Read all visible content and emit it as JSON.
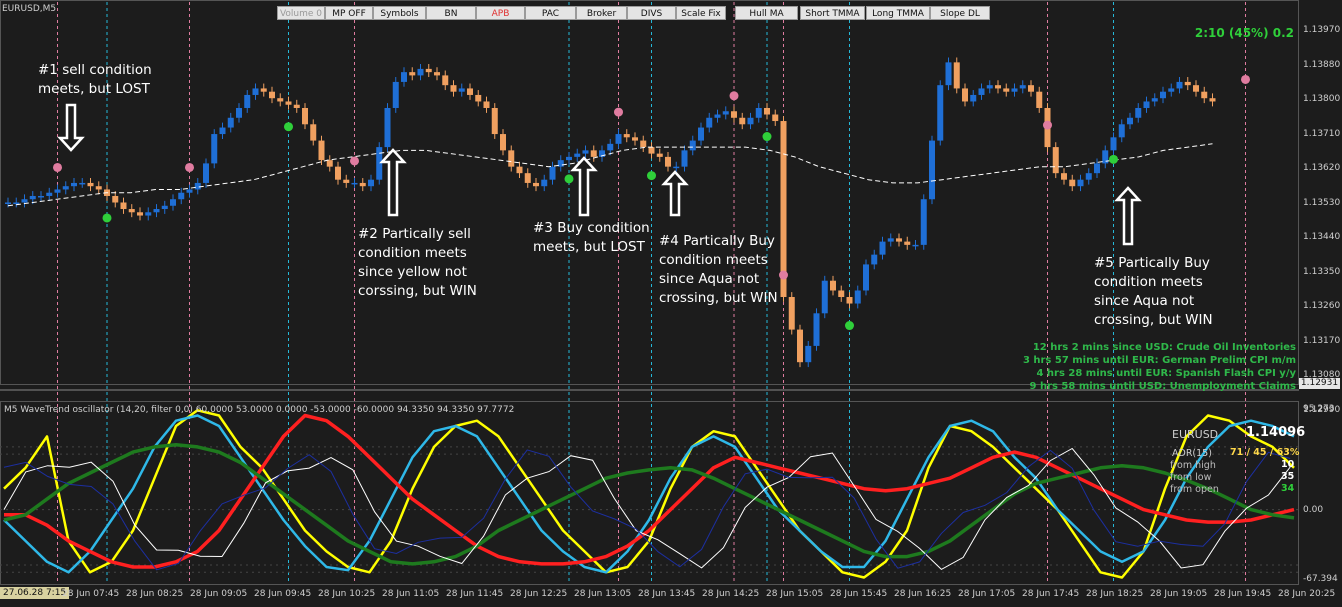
{
  "symbol": "EURUSD,M5",
  "toolbar": [
    {
      "label": "Volume 0",
      "style": "dim"
    },
    {
      "label": "MP OFF",
      "style": ""
    },
    {
      "label": "Symbols",
      "style": ""
    },
    {
      "label": "BN",
      "style": ""
    },
    {
      "label": "APB",
      "style": "red"
    },
    {
      "label": "PAC",
      "style": ""
    },
    {
      "label": "Broker",
      "style": ""
    },
    {
      "label": "DIVS",
      "style": ""
    },
    {
      "label": "Scale Fix",
      "style": ""
    },
    {
      "label": "Hull MA",
      "style": ""
    },
    {
      "label": "Short TMMA",
      "style": ""
    },
    {
      "label": "Long TMMA",
      "style": ""
    },
    {
      "label": "Slope DL",
      "style": ""
    }
  ],
  "stat": "2:10 (45%) 0.2",
  "annotations": [
    {
      "text": "#1 sell condition\nmeets, but LOST"
    },
    {
      "text": "#2 Partically sell\ncondition meets\nsince yellow not\ncorssing, but WIN"
    },
    {
      "text": "#3 Buy condition\nmeets, but LOST"
    },
    {
      "text": "#4 Partically Buy\ncondition meets\nsince Aqua not\ncrossing, but WIN"
    },
    {
      "text": "#5 Partically Buy\ncondition meets\nsince Aqua not\ncrossing, but WIN"
    }
  ],
  "news": [
    "12 hrs 2 mins since USD: Crude Oil Inventories",
    "3 hrs 57 mins until EUR: German Prelim CPI m/m",
    "4 hrs 28 mins until EUR: Spanish Flash CPI y/y",
    "9 hrs 58 mins until USD: Unemployment Claims"
  ],
  "price_axis": [
    "1.13970",
    "1.13880",
    "1.13800",
    "1.13710",
    "1.13620",
    "1.13530",
    "1.13440",
    "1.13350",
    "1.13260",
    "1.13170",
    "1.13080",
    "1.12990"
  ],
  "current_price": "1.12931",
  "osc_title": "M5 WaveTrend oscillator (14,20, filter 0,0) 60.0000 53.0000 0.0000 -53.0000 -60.0000 94.3350 94.3350 97.7772",
  "osc_axis": {
    "top": "95.273",
    "mid": "0.00",
    "bottom": "-67.394"
  },
  "time_first": "27.06.28 7:15",
  "time_axis": [
    "28 Jun 07:45",
    "28 Jun 08:25",
    "28 Jun 09:05",
    "28 Jun 09:45",
    "28 Jun 10:25",
    "28 Jun 11:05",
    "28 Jun 11:45",
    "28 Jun 12:25",
    "28 Jun 13:05",
    "28 Jun 13:45",
    "28 Jun 14:25",
    "28 Jun 15:05",
    "28 Jun 15:45",
    "28 Jun 16:25",
    "28 Jun 17:05",
    "28 Jun 17:45",
    "28 Jun 18:25",
    "28 Jun 19:05",
    "28 Jun 19:45",
    "28 Jun 20:25"
  ],
  "info_panel": {
    "symbol": "EURUSD",
    "price": "1.14096",
    "adr_label": "ADR(15)",
    "adr_value": "71 / 45 / 63%",
    "rows": [
      {
        "label": "from high",
        "value": "10",
        "color": "#ffffff"
      },
      {
        "label": "from low",
        "value": "35",
        "color": "#ffffff"
      },
      {
        "label": "from open",
        "value": "34",
        "color": "#2fcf3a"
      }
    ]
  },
  "colors": {
    "background": "#1c1c1c",
    "bull": "#1f6fd6",
    "bear": "#f0a060",
    "buy_dot": "#2fcf3a",
    "sell_dot": "#e07ca0",
    "vline_pink": "#e07ca0",
    "vline_aqua": "#25b8d8",
    "ma": "#ffffff"
  },
  "chart_data": [
    {
      "type": "candlestick",
      "title": "EURUSD,M5",
      "ylim": [
        1.1293,
        1.1405
      ],
      "x_start": "28 Jun 07:15",
      "x_step_min": 5,
      "close": [
        1.1349,
        1.1349,
        1.135,
        1.1351,
        1.1351,
        1.1352,
        1.1353,
        1.1354,
        1.1355,
        1.1355,
        1.1354,
        1.1353,
        1.1351,
        1.1349,
        1.1347,
        1.1346,
        1.1345,
        1.1346,
        1.1347,
        1.1348,
        1.135,
        1.1352,
        1.1353,
        1.1355,
        1.1361,
        1.137,
        1.1372,
        1.1375,
        1.1378,
        1.1382,
        1.1384,
        1.1383,
        1.1381,
        1.138,
        1.1379,
        1.1378,
        1.1373,
        1.1368,
        1.1362,
        1.136,
        1.1356,
        1.1355,
        1.1355,
        1.1354,
        1.1356,
        1.1366,
        1.1378,
        1.1386,
        1.1389,
        1.1388,
        1.139,
        1.1389,
        1.1388,
        1.1385,
        1.1383,
        1.1384,
        1.1382,
        1.138,
        1.1378,
        1.137,
        1.1365,
        1.136,
        1.1358,
        1.1355,
        1.1354,
        1.1356,
        1.136,
        1.1362,
        1.1363,
        1.1364,
        1.1365,
        1.1363,
        1.1365,
        1.1367,
        1.137,
        1.1369,
        1.1368,
        1.1366,
        1.1364,
        1.1363,
        1.136,
        1.136,
        1.1365,
        1.1368,
        1.1372,
        1.1375,
        1.1376,
        1.1377,
        1.1375,
        1.1373,
        1.1375,
        1.1378,
        1.1376,
        1.1374,
        1.132,
        1.131,
        1.13,
        1.1305,
        1.1315,
        1.1325,
        1.1322,
        1.132,
        1.1318,
        1.1322,
        1.133,
        1.1333,
        1.1337,
        1.1338,
        1.1337,
        1.1336,
        1.1336,
        1.135,
        1.1368,
        1.1385,
        1.1392,
        1.1384,
        1.138,
        1.1382,
        1.1384,
        1.1385,
        1.1384,
        1.1383,
        1.1384,
        1.1385,
        1.1383,
        1.1378,
        1.1366,
        1.1358,
        1.1356,
        1.1354,
        1.1356,
        1.1358,
        1.1361,
        1.1365,
        1.1369,
        1.1373,
        1.1375,
        1.1378,
        1.138,
        1.1381,
        1.1383,
        1.1384,
        1.1386,
        1.1385,
        1.1383,
        1.1381,
        1.138
      ],
      "series": [
        {
          "values": [
            1.1348,
            1.1349,
            1.135,
            1.1351,
            1.1352,
            1.1352,
            1.1353,
            1.1353,
            1.1354,
            1.1355,
            1.1356,
            1.1358,
            1.136,
            1.1362,
            1.1363,
            1.1364,
            1.1365,
            1.1365,
            1.1364,
            1.1363,
            1.1362,
            1.1361,
            1.136,
            1.1361,
            1.1363,
            1.1365,
            1.1366,
            1.1366,
            1.1366,
            1.1366,
            1.1366,
            1.1365,
            1.1363,
            1.136,
            1.1358,
            1.1356,
            1.1355,
            1.1355,
            1.1356,
            1.1357,
            1.1358,
            1.1359,
            1.136,
            1.136,
            1.1361,
            1.1362,
            1.1363,
            1.1365,
            1.1366,
            1.1367
          ]
        }
      ],
      "buy_signals": [
        "28 Jun 08:15",
        "28 Jun 10:05",
        "28 Jun 12:55",
        "28 Jun 13:45",
        "28 Jun 14:55",
        "28 Jun 15:45",
        "28 Jun 18:25"
      ],
      "sell_signals": [
        "28 Jun 07:45",
        "28 Jun 09:05",
        "28 Jun 10:45",
        "28 Jun 13:25",
        "28 Jun 14:35",
        "28 Jun 15:05",
        "28 Jun 17:45",
        "28 Jun 19:45"
      ],
      "vlines_pink": [
        "28 Jun 07:45",
        "28 Jun 09:05",
        "28 Jun 10:45",
        "28 Jun 13:25",
        "28 Jun 14:35",
        "28 Jun 15:05",
        "28 Jun 17:45",
        "28 Jun 19:45"
      ],
      "vlines_aqua": [
        "28 Jun 08:15",
        "28 Jun 10:05",
        "28 Jun 12:55",
        "28 Jun 13:45",
        "28 Jun 14:55",
        "28 Jun 15:45",
        "28 Jun 18:25"
      ]
    },
    {
      "type": "line",
      "title": "M5 WaveTrend oscillator (14,20, filter 0,0)",
      "ylim": [
        -67.394,
        95.273
      ],
      "levels": [
        60,
        53,
        0,
        -53,
        -60
      ],
      "series": [
        {
          "color": "#ffff00",
          "values": [
            20,
            40,
            70,
            -30,
            -60,
            -50,
            -20,
            30,
            80,
            95,
            90,
            60,
            40,
            10,
            -20,
            -40,
            -55,
            -60,
            -30,
            20,
            60,
            80,
            85,
            70,
            40,
            10,
            -20,
            -40,
            -60,
            -55,
            -30,
            20,
            60,
            75,
            70,
            40,
            10,
            -20,
            -40,
            -60,
            -65,
            -50,
            -20,
            40,
            80,
            75,
            60,
            40,
            20,
            0,
            -30,
            -60,
            -65,
            -40,
            20,
            70,
            90,
            85,
            70,
            60,
            40
          ]
        },
        {
          "color": "#2fb8e8",
          "values": [
            -10,
            -30,
            -50,
            -60,
            -40,
            -10,
            20,
            60,
            85,
            90,
            80,
            50,
            20,
            -10,
            -35,
            -55,
            -58,
            -30,
            10,
            50,
            75,
            80,
            70,
            40,
            10,
            -20,
            -40,
            -55,
            -60,
            -40,
            -10,
            30,
            60,
            70,
            60,
            30,
            0,
            -20,
            -40,
            -55,
            -55,
            -30,
            10,
            50,
            80,
            85,
            75,
            50,
            30,
            0,
            -20,
            -40,
            -50,
            -40,
            -10,
            30,
            60,
            80,
            85,
            80,
            70
          ]
        },
        {
          "color": "#ff2020",
          "values": [
            -5,
            -5,
            -15,
            -30,
            -40,
            -50,
            -55,
            -55,
            -50,
            -40,
            -20,
            10,
            40,
            70,
            90,
            85,
            70,
            50,
            30,
            10,
            -5,
            -20,
            -35,
            -45,
            -50,
            -52,
            -52,
            -50,
            -45,
            -35,
            -20,
            0,
            20,
            40,
            50,
            45,
            40,
            35,
            30,
            25,
            20,
            18,
            20,
            25,
            30,
            40,
            50,
            55,
            50,
            40,
            30,
            20,
            10,
            0,
            -5,
            -10,
            -12,
            -12,
            -10,
            -5,
            0
          ]
        },
        {
          "color": "#1e7a1e",
          "values": [
            -10,
            -5,
            10,
            25,
            35,
            45,
            55,
            60,
            62,
            60,
            55,
            45,
            30,
            15,
            0,
            -15,
            -30,
            -40,
            -50,
            -52,
            -50,
            -45,
            -35,
            -20,
            -10,
            0,
            10,
            20,
            30,
            35,
            38,
            40,
            38,
            30,
            20,
            10,
            0,
            -10,
            -20,
            -30,
            -40,
            -45,
            -45,
            -40,
            -30,
            -15,
            0,
            15,
            25,
            30,
            35,
            40,
            42,
            40,
            35,
            28,
            20,
            10,
            0,
            -5,
            -8
          ]
        }
      ]
    }
  ]
}
